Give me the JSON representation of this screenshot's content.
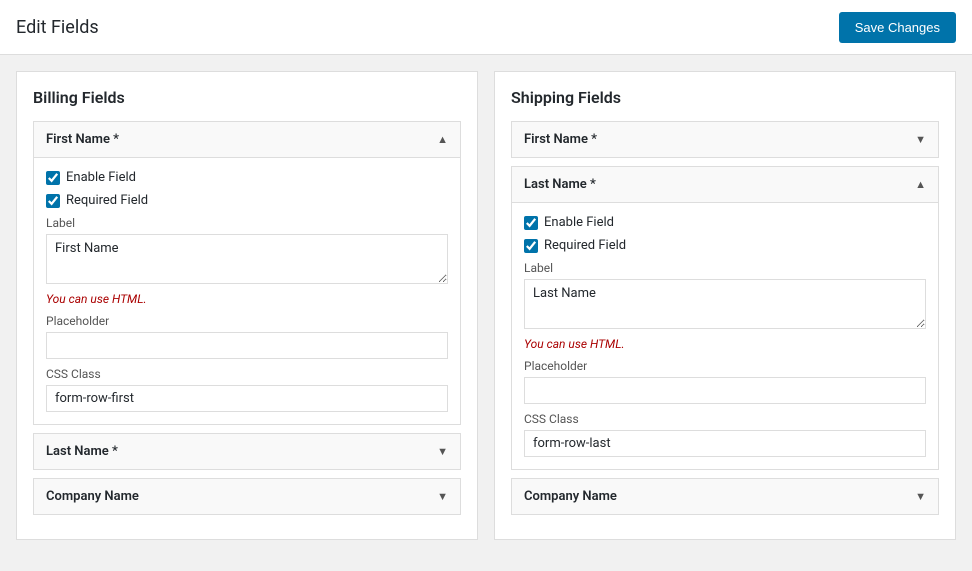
{
  "header": {
    "title": "Edit Fields",
    "save_button_label": "Save Changes"
  },
  "billing": {
    "column_title": "Billing Fields",
    "fields": [
      {
        "id": "billing-first-name",
        "label": "First Name *",
        "expanded": true,
        "enable_checked": true,
        "required_checked": true,
        "label_value": "First Name",
        "placeholder_value": "",
        "css_class_value": "form-row-first",
        "label_field_label": "Label",
        "placeholder_field_label": "Placeholder",
        "css_class_field_label": "CSS Class",
        "html_hint": "You can use HTML."
      },
      {
        "id": "billing-last-name",
        "label": "Last Name *",
        "expanded": false
      },
      {
        "id": "billing-company",
        "label": "Company Name",
        "expanded": false
      }
    ]
  },
  "shipping": {
    "column_title": "Shipping Fields",
    "fields": [
      {
        "id": "shipping-first-name",
        "label": "First Name *",
        "expanded": false
      },
      {
        "id": "shipping-last-name",
        "label": "Last Name *",
        "expanded": true,
        "enable_checked": true,
        "required_checked": true,
        "label_value": "Last Name",
        "placeholder_value": "",
        "css_class_value": "form-row-last",
        "label_field_label": "Label",
        "placeholder_field_label": "Placeholder",
        "css_class_field_label": "CSS Class",
        "html_hint": "You can use HTML."
      },
      {
        "id": "shipping-company",
        "label": "Company Name",
        "expanded": false
      }
    ]
  },
  "labels": {
    "enable_field": "Enable Field",
    "required_field": "Required Field",
    "chevron_up": "▲",
    "chevron_down": "▼"
  }
}
